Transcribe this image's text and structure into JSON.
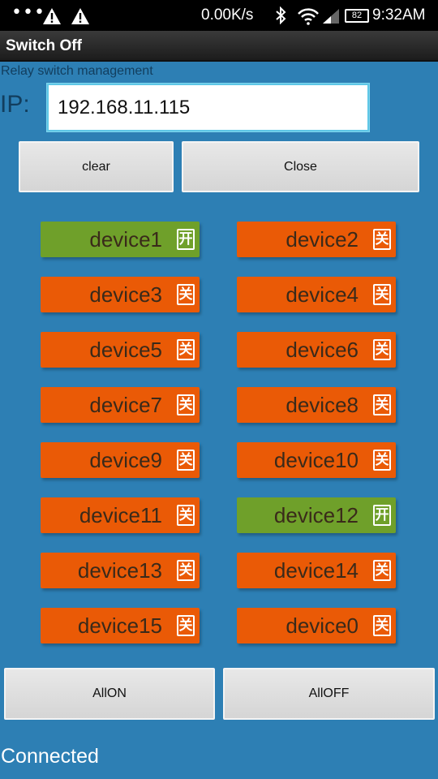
{
  "statusbar": {
    "speed": "0.00K/s",
    "battery": "82",
    "time": "9:32AM"
  },
  "titlebar": {
    "title": "Switch Off"
  },
  "subtitle": "Relay switch management",
  "ip": {
    "label": "IP:",
    "value": "192.168.11.115"
  },
  "buttons": {
    "clear": "clear",
    "close": "Close",
    "all_on": "AllON",
    "all_off": "AllOFF"
  },
  "devices": [
    {
      "name": "device1",
      "state": "on",
      "toggle": "开"
    },
    {
      "name": "device2",
      "state": "off",
      "toggle": "关"
    },
    {
      "name": "device3",
      "state": "off",
      "toggle": "关"
    },
    {
      "name": "device4",
      "state": "off",
      "toggle": "关"
    },
    {
      "name": "device5",
      "state": "off",
      "toggle": "关"
    },
    {
      "name": "device6",
      "state": "off",
      "toggle": "关"
    },
    {
      "name": "device7",
      "state": "off",
      "toggle": "关"
    },
    {
      "name": "device8",
      "state": "off",
      "toggle": "关"
    },
    {
      "name": "device9",
      "state": "off",
      "toggle": "关"
    },
    {
      "name": "device10",
      "state": "off",
      "toggle": "关"
    },
    {
      "name": "device11",
      "state": "off",
      "toggle": "关"
    },
    {
      "name": "device12",
      "state": "on",
      "toggle": "开"
    },
    {
      "name": "device13",
      "state": "off",
      "toggle": "关"
    },
    {
      "name": "device14",
      "state": "off",
      "toggle": "关"
    },
    {
      "name": "device15",
      "state": "off",
      "toggle": "关"
    },
    {
      "name": "device0",
      "state": "off",
      "toggle": "关"
    }
  ],
  "connection_status": "Connected",
  "colors": {
    "background": "#2d7fb4",
    "device_off": "#ea5a06",
    "device_on": "#6fa02a"
  },
  "icons": [
    "more-dots-icon",
    "warning-icon",
    "bluetooth-icon",
    "wifi-icon",
    "signal-icon",
    "battery-icon"
  ]
}
